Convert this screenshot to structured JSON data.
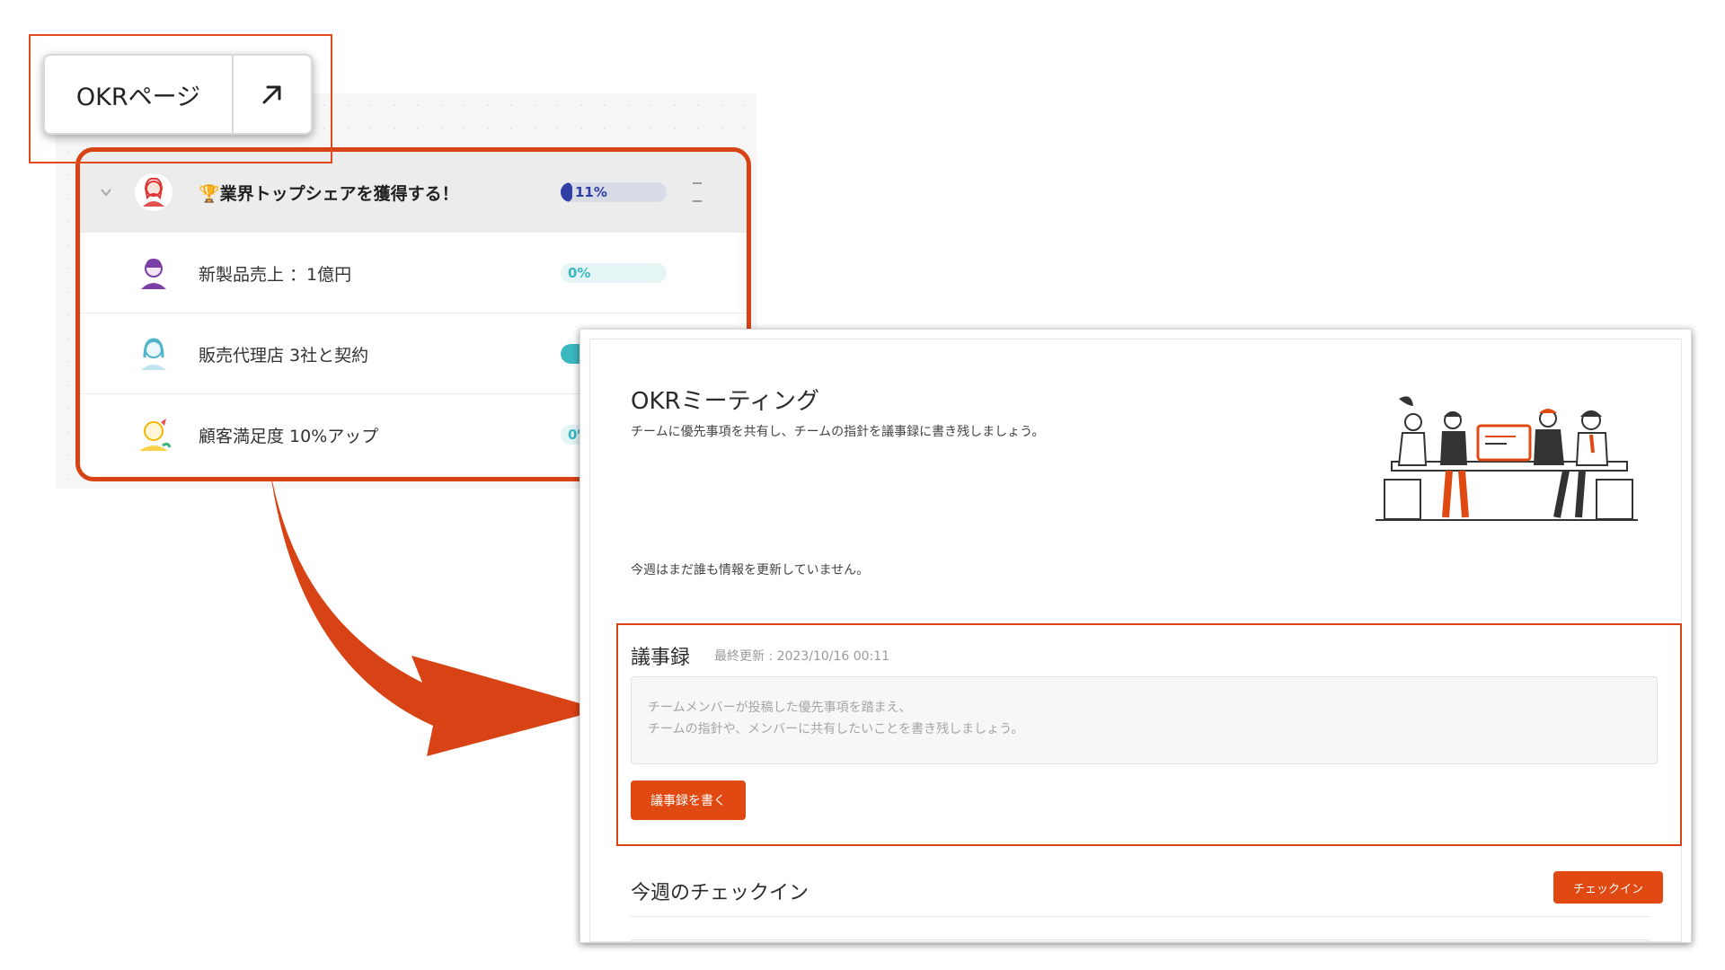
{
  "okr_button": {
    "label": "OKRページ",
    "icon": "external-link-arrow-icon"
  },
  "okr_list": {
    "objective": {
      "title": "🏆業界トップシェアを獲得する！",
      "progress_label": "11%",
      "progress": 0.11,
      "bar_color": "#2f3fa6"
    },
    "key_results": [
      {
        "title": "新製品売上 ：1億円",
        "progress_label": "0%",
        "progress": 0.0,
        "avatar_color": "#7b3fa6"
      },
      {
        "title": "販売代理店 3社と契約",
        "progress_label": "",
        "progress": 0.0,
        "avatar_color": "#4fb3c9"
      },
      {
        "title": "顧客満足度 10%アップ",
        "progress_label": "0%",
        "progress": 0.0,
        "avatar_color": "#f2b705"
      }
    ]
  },
  "meeting": {
    "title": "OKRミーティング",
    "subtitle": "チームに優先事項を共有し、チームの指針を議事録に書き残しましょう。",
    "no_update": "今週はまだ誰も情報を更新していません。",
    "minutes": {
      "heading": "議事録",
      "updated": "最終更新 : 2023/10/16 00:11",
      "placeholder_line1": "チームメンバーが投稿した優先事項を踏まえ、",
      "placeholder_line2": "チームの指針や、メンバーに共有したいことを書き残しましょう。",
      "button_label": "議事録を書く"
    },
    "checkin": {
      "heading": "今週のチェックイン",
      "button_label": "チェックイン"
    }
  },
  "colors": {
    "accent": "#e04a12",
    "highlight": "#d84315",
    "progress_teal": "#3bb7c0",
    "progress_blue": "#2f3fa6"
  }
}
